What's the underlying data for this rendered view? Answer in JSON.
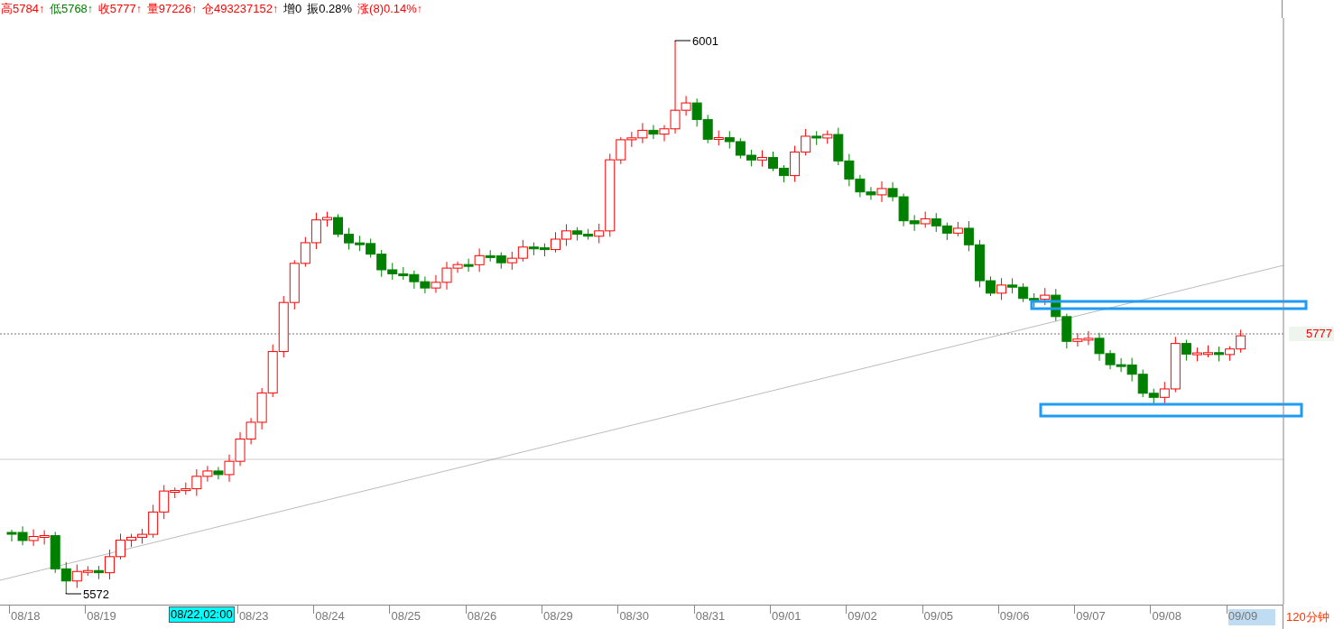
{
  "quote_bar": [
    {
      "label": "高",
      "value": "5784",
      "arrow": "↑",
      "color": "#ff0000"
    },
    {
      "label": "低",
      "value": "5768",
      "arrow": "↑",
      "color": "#008000"
    },
    {
      "label": "收",
      "value": "5777",
      "arrow": "↑",
      "color": "#ff0000"
    },
    {
      "label": "量",
      "value": "97226",
      "arrow": "↑",
      "color": "#ff0000"
    },
    {
      "label": "仓",
      "value": "493237152",
      "arrow": "↑",
      "color": "#ff0000"
    },
    {
      "label": "增",
      "value": "0"
    },
    {
      "label": "振",
      "value": "0.28%"
    },
    {
      "label": "涨",
      "value": "(8)0.14%",
      "arrow": "↑",
      "color": "#ff0000"
    }
  ],
  "chart": {
    "high_label": "6001",
    "low_label": "5572",
    "price_tag": "5777"
  },
  "x_axis": {
    "dates": [
      {
        "label": "08/18",
        "selected": false
      },
      {
        "label": "08/19",
        "selected": false
      },
      {
        "label": "08/23",
        "selected": false
      },
      {
        "label": "08/24",
        "selected": false
      },
      {
        "label": "08/25",
        "selected": false
      },
      {
        "label": "08/26",
        "selected": false
      },
      {
        "label": "08/29",
        "selected": false
      },
      {
        "label": "08/30",
        "selected": false
      },
      {
        "label": "08/31",
        "selected": false
      },
      {
        "label": "09/01",
        "selected": false
      },
      {
        "label": "09/02",
        "selected": false
      },
      {
        "label": "09/05",
        "selected": false
      },
      {
        "label": "09/06",
        "selected": false
      },
      {
        "label": "09/07",
        "selected": false
      },
      {
        "label": "09/08",
        "selected": false
      },
      {
        "label": "09/09",
        "selected": true
      }
    ],
    "cursor_label": "08/22,02:00",
    "period": "120分钟"
  }
}
